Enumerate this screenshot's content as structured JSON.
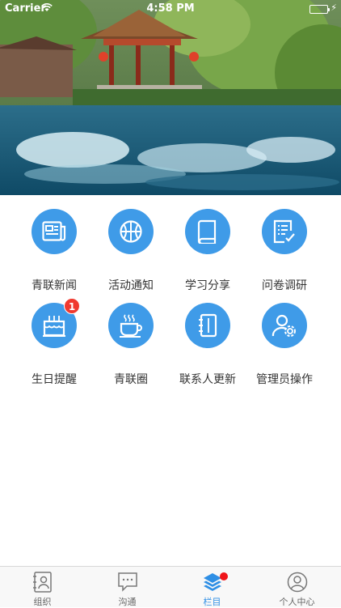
{
  "status": {
    "carrier": "Carrier",
    "time": "4:58 PM"
  },
  "grid": {
    "items": [
      {
        "label": "青联新闻",
        "icon": "newspaper-icon"
      },
      {
        "label": "活动通知",
        "icon": "basketball-icon"
      },
      {
        "label": "学习分享",
        "icon": "book-icon"
      },
      {
        "label": "问卷调研",
        "icon": "checklist-icon"
      },
      {
        "label": "生日提醒",
        "icon": "birthday-cake-icon",
        "badge": "1"
      },
      {
        "label": "青联圈",
        "icon": "coffee-cup-icon"
      },
      {
        "label": "联系人更新",
        "icon": "address-book-icon"
      },
      {
        "label": "管理员操作",
        "icon": "admin-settings-icon"
      }
    ]
  },
  "tabbar": {
    "tabs": [
      {
        "label": "组织",
        "icon": "contacts-card-icon"
      },
      {
        "label": "沟通",
        "icon": "chat-bubble-icon"
      },
      {
        "label": "栏目",
        "icon": "layers-icon",
        "active": true
      },
      {
        "label": "个人中心",
        "icon": "user-profile-icon"
      }
    ]
  },
  "colors": {
    "accent": "#3f9be8",
    "badge": "#f0392f",
    "tab_active": "#2f8fe5"
  }
}
